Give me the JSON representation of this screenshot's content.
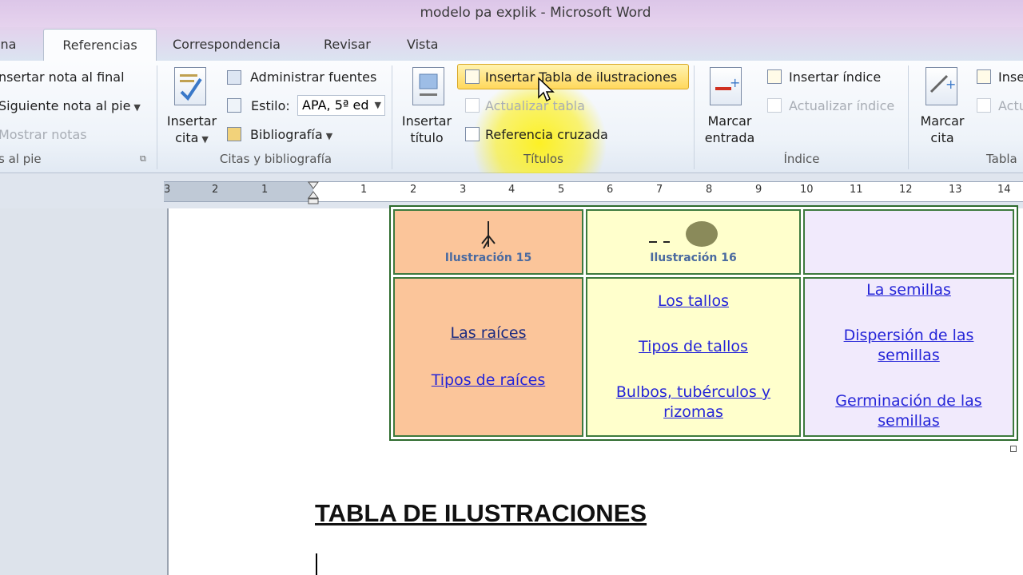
{
  "window": {
    "title": "modelo pa explik  -  Microsoft Word"
  },
  "tabs": [
    {
      "label": "ina"
    },
    {
      "label": "Referencias"
    },
    {
      "label": "Correspondencia"
    },
    {
      "label": "Revisar"
    },
    {
      "label": "Vista"
    }
  ],
  "ribbon": {
    "footnotes": {
      "insert_endnote": "nsertar nota al final",
      "next_footnote": "Siguiente nota al pie",
      "show_notes": "Mostrar notas",
      "group": "s al pie"
    },
    "citations": {
      "insert_citation_1": "Insertar",
      "insert_citation_2": "cita",
      "manage_sources": "Administrar fuentes",
      "style_label": "Estilo:",
      "style_value": "APA, 5ª ed",
      "bibliography": "Bibliografía",
      "group": "Citas y bibliografía"
    },
    "captions": {
      "insert_caption_1": "Insertar",
      "insert_caption_2": "título",
      "insert_table_figures": "Insertar Tabla de ilustraciones",
      "update_table": "Actualizar tabla",
      "cross_reference": "Referencia cruzada",
      "group": "Títulos"
    },
    "index": {
      "mark_entry_1": "Marcar",
      "mark_entry_2": "entrada",
      "insert_index": "Insertar índice",
      "update_index": "Actualizar índice",
      "group": "Índice"
    },
    "authorities": {
      "mark_citation_1": "Marcar",
      "mark_citation_2": "cita",
      "insert": "Inse",
      "update": "Actu",
      "group": "Tabla"
    }
  },
  "ruler": {
    "numbers": [
      "3",
      "2",
      "1",
      "1",
      "2",
      "3",
      "4",
      "5",
      "6",
      "7",
      "8",
      "9",
      "10",
      "11",
      "12",
      "13",
      "14"
    ]
  },
  "document": {
    "captions": [
      "Ilustración 15",
      "Ilustración 16"
    ],
    "col1_links": [
      "Las raíces",
      "Tipos de raíces"
    ],
    "col2_links": [
      "Los tallos",
      "Tipos de tallos",
      "Bulbos, tubérculos y rizomas"
    ],
    "col3_links": [
      "La semillas",
      "Dispersión de las semillas",
      "Germinación de las semillas"
    ],
    "heading": "TABLA DE ILUSTRACIONES"
  },
  "colors": {
    "highlight": "#ffd85c",
    "cell_orange": "#fbc59a",
    "cell_yellow": "#ffffcc",
    "cell_lilac": "#f1eafc",
    "link": "#2525d8"
  }
}
